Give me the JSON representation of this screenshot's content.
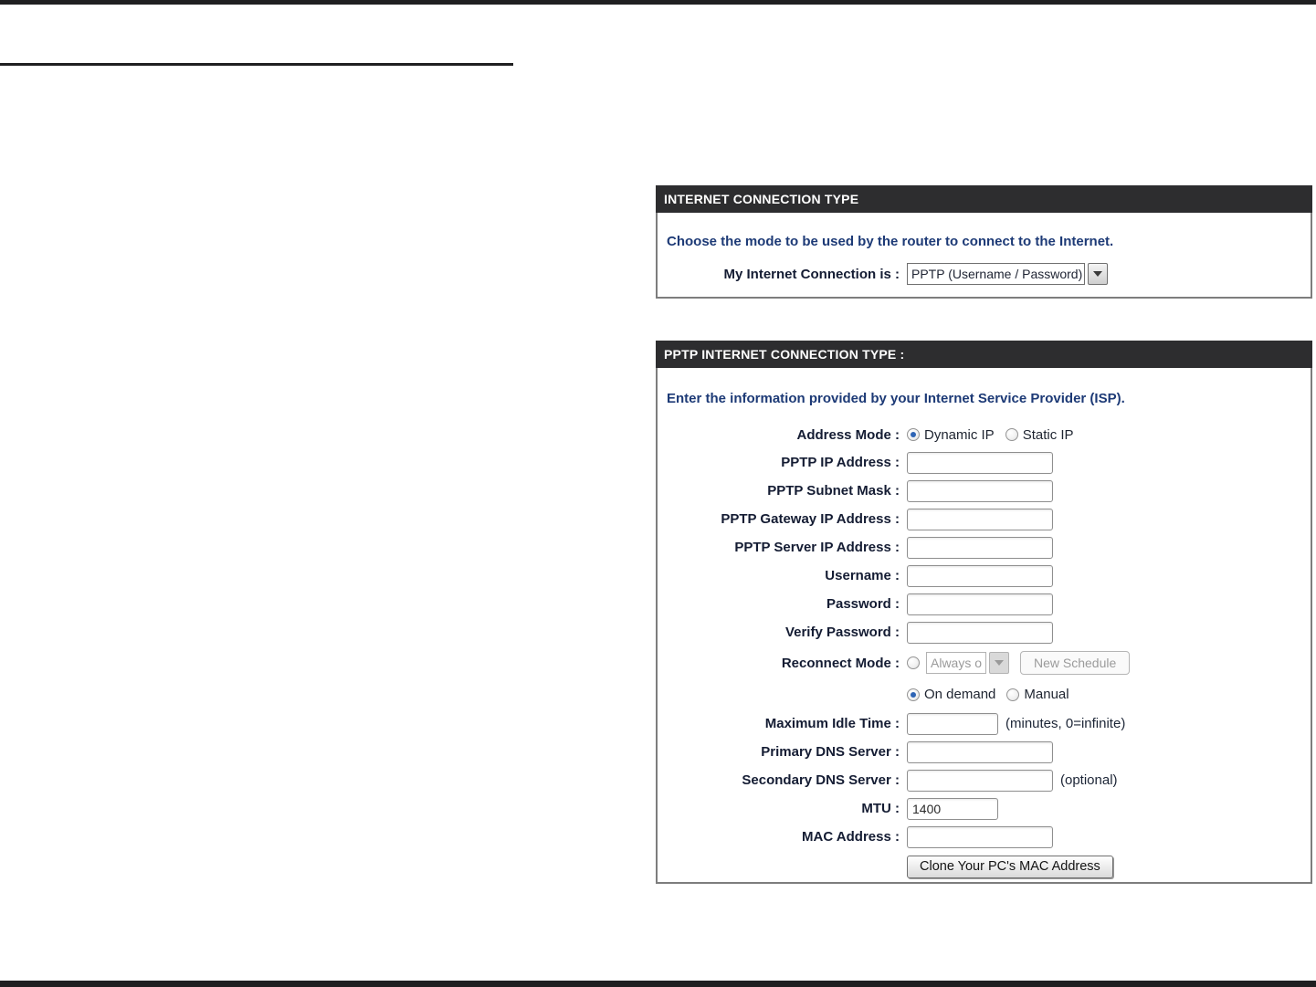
{
  "colors": {
    "bar_black": "#1f1f21",
    "panel_header_bg": "#2d2d2f",
    "panel_border": "#7d7d7d",
    "instruction_blue": "#1d3a76",
    "label_navy": "#141c33",
    "radio_selected_blue": "#2e64b5"
  },
  "panel1": {
    "header": "INTERNET CONNECTION TYPE",
    "instruction": "Choose the mode to be used by the router to connect to the Internet.",
    "connection": {
      "label": "My Internet Connection is :",
      "value": "PPTP (Username / Password)"
    }
  },
  "panel2": {
    "header": "PPTP INTERNET CONNECTION TYPE :",
    "instruction": "Enter the information provided by your Internet Service Provider (ISP).",
    "address_mode": {
      "label": "Address Mode :",
      "dynamic": "Dynamic IP",
      "static": "Static IP",
      "selected": "Dynamic IP"
    },
    "pptp_ip": {
      "label": "PPTP IP Address :",
      "value": ""
    },
    "pptp_subnet": {
      "label": "PPTP Subnet Mask :",
      "value": ""
    },
    "pptp_gateway": {
      "label": "PPTP Gateway IP Address :",
      "value": ""
    },
    "pptp_server": {
      "label": "PPTP Server IP Address :",
      "value": ""
    },
    "username": {
      "label": "Username :",
      "value": ""
    },
    "password": {
      "label": "Password :",
      "value": ""
    },
    "verify_password": {
      "label": "Verify Password :",
      "value": ""
    },
    "reconnect": {
      "label": "Reconnect Mode :",
      "schedule_value": "Always o",
      "new_schedule_button": "New Schedule",
      "on_demand": "On demand",
      "manual": "Manual",
      "selected": "On demand"
    },
    "max_idle": {
      "label": "Maximum Idle Time :",
      "value": "",
      "note": "(minutes, 0=infinite)"
    },
    "primary_dns": {
      "label": "Primary DNS Server :",
      "value": ""
    },
    "secondary_dns": {
      "label": "Secondary DNS Server :",
      "value": "",
      "note": "(optional)"
    },
    "mtu": {
      "label": "MTU :",
      "value": "1400"
    },
    "mac": {
      "label": "MAC Address :",
      "value": ""
    },
    "clone_button": "Clone Your PC's MAC Address"
  }
}
